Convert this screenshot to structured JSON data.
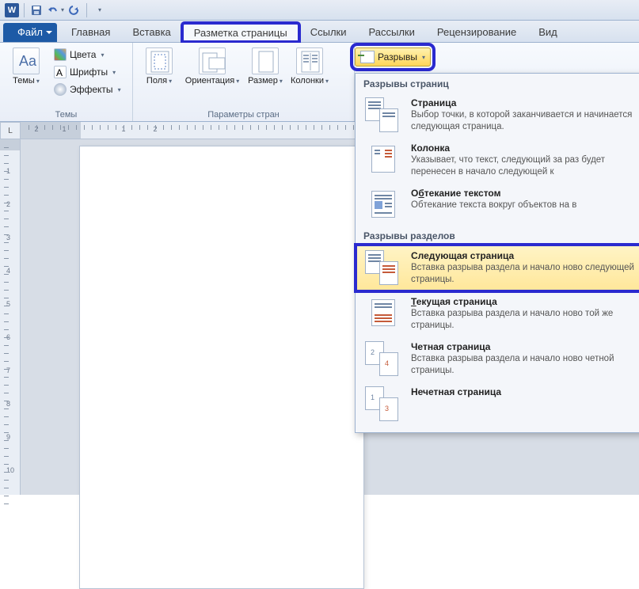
{
  "quickAccess": {
    "app": "W"
  },
  "tabs": {
    "file": "Файл",
    "home": "Главная",
    "insert": "Вставка",
    "pageLayout": "Разметка страницы",
    "references": "Ссылки",
    "mailings": "Рассылки",
    "review": "Рецензирование",
    "view": "Вид"
  },
  "ribbon": {
    "themes": {
      "themes": "Темы",
      "colors": "Цвета",
      "fonts": "Шрифты",
      "effects": "Эффекты",
      "groupLabel": "Темы"
    },
    "pageSetup": {
      "margins": "Поля",
      "orientation": "Ориентация",
      "size": "Размер",
      "columns": "Колонки",
      "groupLabel": "Параметры стран"
    },
    "breaksBtn": "Разрывы"
  },
  "rulerCorner": "L",
  "hRulerNums": [
    "2",
    "1",
    "1",
    "2"
  ],
  "vRulerNums": [
    "1",
    "2",
    "3",
    "4",
    "5",
    "6",
    "7",
    "8",
    "9",
    "10"
  ],
  "gallery": {
    "header1": "Разрывы страниц",
    "header2": "Разрывы разделов",
    "items": {
      "page": {
        "title": "Страница",
        "desc": "Выбор точки, в которой заканчивается и начинается следующая страница."
      },
      "column": {
        "title": "Колонка",
        "desc": "Указывает, что текст, следующий за раз будет перенесен в начало следующей к"
      },
      "textWrap": {
        "title": "Обтекание текстом",
        "desc": "Обтекание текста вокруг объектов на в"
      },
      "nextPage": {
        "title": "Следующая страница",
        "desc": "Вставка разрыва раздела и начало ново следующей страницы."
      },
      "continuous": {
        "title": "Текущая страница",
        "desc": "Вставка разрыва раздела и начало ново той же страницы."
      },
      "evenPage": {
        "title": "Четная страница",
        "desc": "Вставка разрыва раздела и начало ново четной страницы."
      },
      "oddPage": {
        "title": "Нечетная страница"
      }
    }
  }
}
